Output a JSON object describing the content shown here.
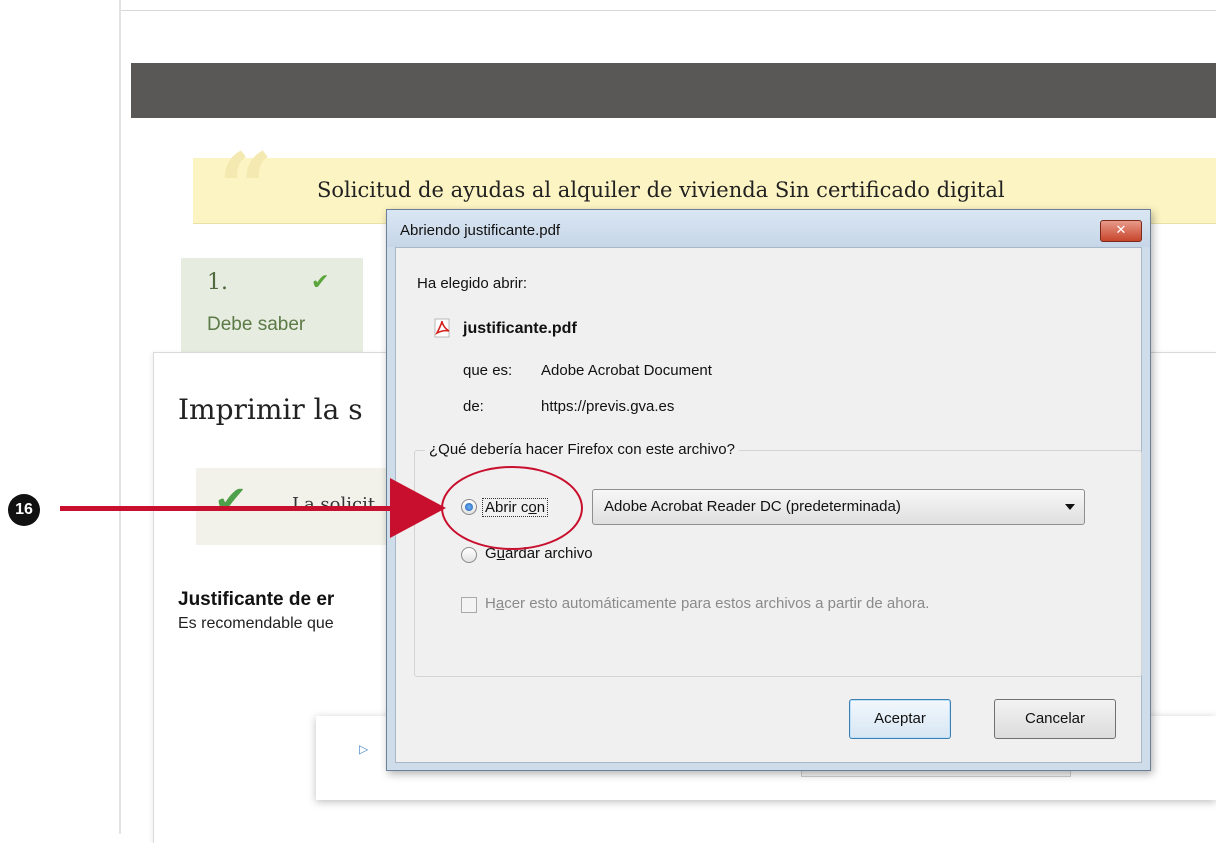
{
  "page": {
    "banner_title": "Solicitud de ayudas al alquiler de vivienda Sin certificado digital",
    "step": {
      "number": "1.",
      "label": "Debe saber"
    },
    "heading": "Imprimir la s",
    "success_text": "La solicit",
    "section_title": "Justificante de er",
    "section_desc": "Es recomendable que"
  },
  "annotation": {
    "badge": "16"
  },
  "dialog": {
    "title": "Abriendo justificante.pdf",
    "close_symbol": "✕",
    "chosen_label": "Ha elegido abrir:",
    "file_name": "justificante.pdf",
    "type_label": "que es:",
    "type_value": "Adobe Acrobat Document",
    "from_label": "de:",
    "from_value": "https://previs.gva.es",
    "question": "¿Qué debería hacer Firefox con este archivo?",
    "open_with": {
      "label_prefix": "Abrir c",
      "label_access": "o",
      "label_suffix": "n",
      "selected": true,
      "app": "Adobe Acrobat Reader DC  (predeterminada)"
    },
    "save": {
      "label_prefix": "G",
      "label_access": "u",
      "label_suffix": "ardar archivo",
      "selected": false
    },
    "auto": {
      "label_prefix": "H",
      "label_access": "a",
      "label_suffix": "cer esto automáticamente para estos archivos a partir de ahora.",
      "checked": false,
      "enabled": false
    },
    "ok_label": "Aceptar",
    "cancel_label": "Cancelar"
  },
  "icons": {
    "pdf": "pdf-file-icon",
    "check": "checkmark-icon",
    "arrow": "play-arrow-icon"
  },
  "colors": {
    "annotation_red": "#c8102e",
    "header_dark": "#5a5857",
    "banner_yellow": "#fcf4c2",
    "step_green": "#e6ece0"
  }
}
